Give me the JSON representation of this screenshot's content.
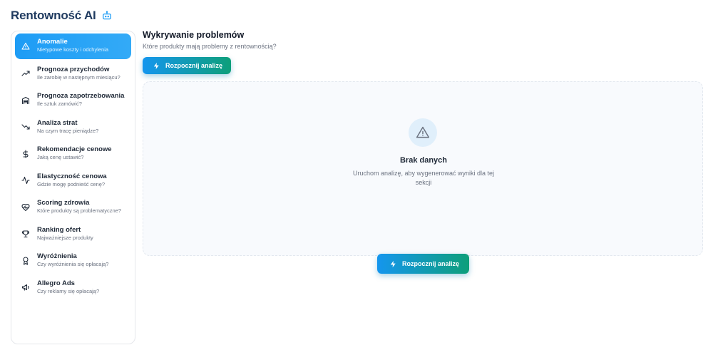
{
  "app": {
    "title": "Rentowność AI",
    "icon": "bot-icon"
  },
  "sidebar": {
    "items": [
      {
        "label": "Anomalie",
        "sub": "Nietypowe koszty i odchylenia",
        "icon": "alert-triangle-icon",
        "active": true
      },
      {
        "label": "Prognoza przychodów",
        "sub": "Ile zarobię w następnym miesiącu?",
        "icon": "trending-up-icon"
      },
      {
        "label": "Prognoza zapotrzebowania",
        "sub": "Ile sztuk zamówić?",
        "icon": "warehouse-icon"
      },
      {
        "label": "Analiza strat",
        "sub": "Na czym tracę pieniądze?",
        "icon": "trending-down-icon"
      },
      {
        "label": "Rekomendacje cenowe",
        "sub": "Jaką cenę ustawić?",
        "icon": "dollar-icon"
      },
      {
        "label": "Elastyczność cenowa",
        "sub": "Gdzie mogę podnieść cenę?",
        "icon": "activity-icon"
      },
      {
        "label": "Scoring zdrowia",
        "sub": "Które produkty są problematyczne?",
        "icon": "heart-pulse-icon"
      },
      {
        "label": "Ranking ofert",
        "sub": "Najważniejsze produkty",
        "icon": "trophy-icon"
      },
      {
        "label": "Wyróżnienia",
        "sub": "Czy wyróżnienia się opłacają?",
        "icon": "award-icon"
      },
      {
        "label": "Allegro Ads",
        "sub": "Czy reklamy się opłacają?",
        "icon": "megaphone-icon"
      }
    ]
  },
  "main": {
    "title": "Wykrywanie problemów",
    "subtitle": "Które produkty mają problemy z rentownością?",
    "start_button": "Rozpocznij analizę",
    "empty_state": {
      "icon": "alert-triangle-icon",
      "title": "Brak danych",
      "text": "Uruchom analizę, aby wygenerować wyniki dla tej sekcji",
      "button": "Rozpocznij analizę"
    }
  },
  "colors": {
    "accent": "#1d9cf5",
    "gradient_end": "#0e9f7a",
    "title": "#1f3a5f",
    "muted": "#6b7280"
  }
}
